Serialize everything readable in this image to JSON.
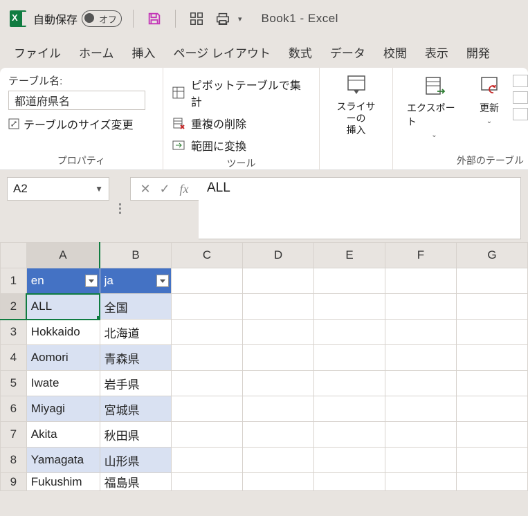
{
  "app": {
    "autosave_label": "自動保存",
    "autosave_state": "オフ",
    "title": "Book1  -  Excel"
  },
  "tabs": {
    "file": "ファイル",
    "home": "ホーム",
    "insert": "挿入",
    "layout": "ページ レイアウト",
    "formulas": "数式",
    "data": "データ",
    "review": "校閲",
    "view": "表示",
    "developer": "開発"
  },
  "ribbon": {
    "props": {
      "tablename_label": "テーブル名:",
      "tablename_value": "都道府県名",
      "resize": "テーブルのサイズ変更",
      "group": "プロパティ"
    },
    "tools": {
      "pivot": "ピボットテーブルで集計",
      "dedup": "重複の削除",
      "torange": "範囲に変換",
      "group": "ツール"
    },
    "slicer": {
      "line1": "スライサーの",
      "line2": "挿入"
    },
    "export": {
      "label": "エクスポート"
    },
    "refresh": {
      "label": "更新"
    },
    "external_group": "外部のテーブル"
  },
  "namebox": "A2",
  "formula": "ALL",
  "columns": [
    "A",
    "B",
    "C",
    "D",
    "E",
    "F",
    "G"
  ],
  "table": {
    "headers": {
      "en": "en",
      "ja": "ja"
    },
    "rows": [
      {
        "n": "1"
      },
      {
        "n": "2",
        "en": "ALL",
        "ja": "全国"
      },
      {
        "n": "3",
        "en": "Hokkaido",
        "ja": "北海道"
      },
      {
        "n": "4",
        "en": "Aomori",
        "ja": "青森県"
      },
      {
        "n": "5",
        "en": "Iwate",
        "ja": "岩手県"
      },
      {
        "n": "6",
        "en": "Miyagi",
        "ja": "宮城県"
      },
      {
        "n": "7",
        "en": "Akita",
        "ja": "秋田県"
      },
      {
        "n": "8",
        "en": "Yamagata",
        "ja": "山形県"
      },
      {
        "n": "9",
        "en": "Fukushim",
        "ja": "福島県"
      }
    ]
  }
}
